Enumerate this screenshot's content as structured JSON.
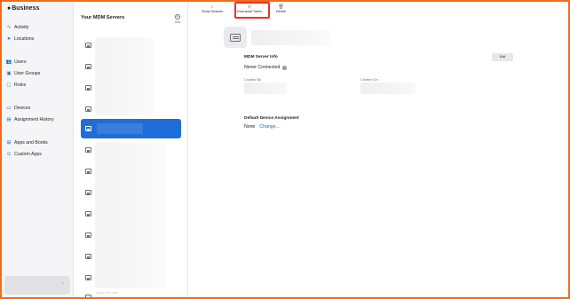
{
  "sidebar": {
    "brand": "Business",
    "brand_icon": "apple-logo",
    "items": [
      {
        "label": "Activity",
        "icon": "activity-icon",
        "glyph": "∿"
      },
      {
        "label": "Locations",
        "icon": "location-icon",
        "glyph": "➤"
      },
      {
        "label": "Users",
        "icon": "users-icon",
        "glyph": "👥"
      },
      {
        "label": "User Groups",
        "icon": "user-groups-icon",
        "glyph": "▣"
      },
      {
        "label": "Roles",
        "icon": "roles-icon",
        "glyph": "▢"
      },
      {
        "label": "Devices",
        "icon": "devices-icon",
        "glyph": "▭"
      },
      {
        "label": "Assignment History",
        "icon": "history-icon",
        "glyph": "▤"
      },
      {
        "label": "Apps and Books",
        "icon": "apps-icon",
        "glyph": "⊞"
      },
      {
        "label": "Custom Apps",
        "icon": "custom-apps-icon",
        "glyph": "⊙"
      }
    ],
    "footer_chevron": "⌃"
  },
  "list": {
    "title": "Your MDM Servers",
    "add_label": "Add",
    "add_glyph": "+",
    "cutoff_text": "Apple Servers"
  },
  "toolbar": {
    "show_devices": "Show Devices",
    "download_token": "Download Token",
    "delete": "Delete"
  },
  "detail": {
    "section_info": "MDM Server Info",
    "status": "Never Connected",
    "info_glyph": "i",
    "edit_label": "Edit",
    "created_by_label": "Created By",
    "created_on_label": "Created On",
    "assignment_title": "Default Device Assignment",
    "assignment_value": "None",
    "change_link": "Change..."
  },
  "colors": {
    "accent": "#1f6dd8",
    "highlight": "#e5342c",
    "frame": "#f26b1d"
  }
}
